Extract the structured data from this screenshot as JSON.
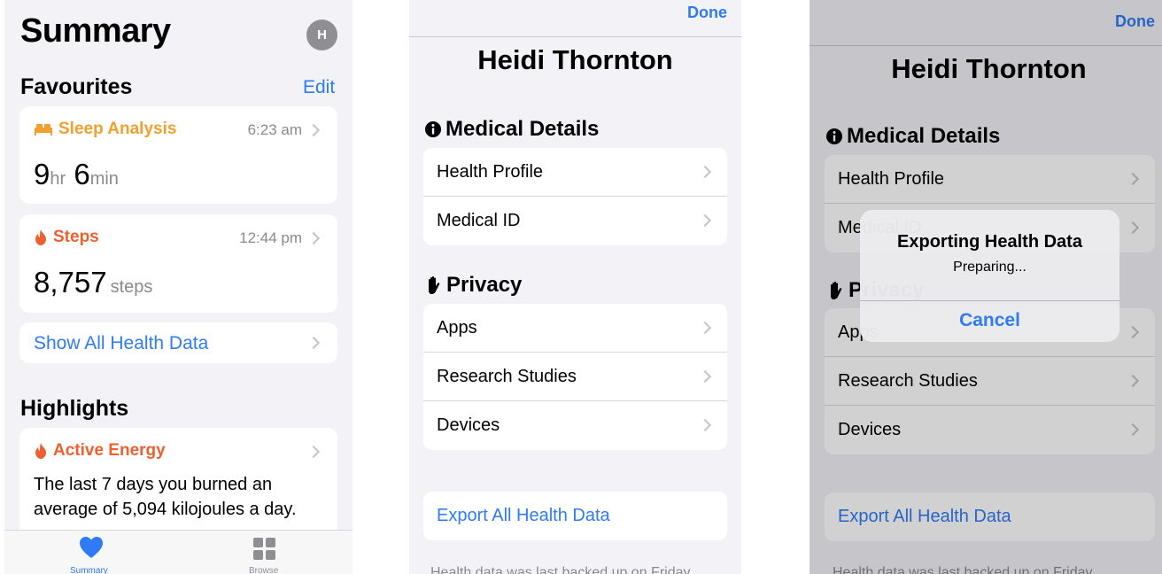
{
  "summary": {
    "title": "Summary",
    "avatar_initial": "H",
    "favourites_heading": "Favourites",
    "edit_label": "Edit",
    "sleep": {
      "title": "Sleep Analysis",
      "time": "6:23 am",
      "hours": "9",
      "hours_unit": "hr",
      "minutes": "6",
      "minutes_unit": "min"
    },
    "steps": {
      "title": "Steps",
      "time": "12:44 pm",
      "value": "8,757",
      "unit": "steps"
    },
    "show_all_label": "Show All Health Data",
    "highlights_heading": "Highlights",
    "active_energy": {
      "title": "Active Energy",
      "text": "The last 7 days you burned an average of 5,094 kilojoules a day."
    },
    "tabs": [
      {
        "label": "Summary"
      },
      {
        "label": "Browse"
      }
    ]
  },
  "profile": {
    "done_label": "Done",
    "name": "Heidi Thornton",
    "medical_heading": "Medical Details",
    "medical_items": [
      {
        "label": "Health Profile"
      },
      {
        "label": "Medical ID"
      }
    ],
    "privacy_heading": "Privacy",
    "privacy_items": [
      {
        "label": "Apps"
      },
      {
        "label": "Research Studies"
      },
      {
        "label": "Devices"
      }
    ],
    "export_label": "Export All Health Data",
    "footer_note": "Health data was last backed up on Friday"
  },
  "export_alert": {
    "title": "Exporting Health Data",
    "message": "Preparing...",
    "cancel_label": "Cancel"
  },
  "colors": {
    "accent": "#2f7bf5",
    "sleep": "#f1a030",
    "activity": "#ef6030",
    "background": "#f2f2f7"
  }
}
